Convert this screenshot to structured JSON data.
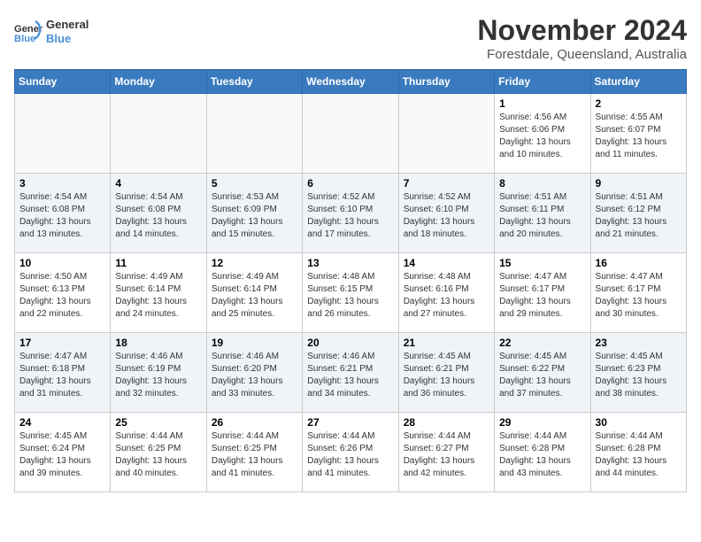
{
  "logo": {
    "line1": "General",
    "line2": "Blue"
  },
  "title": "November 2024",
  "subtitle": "Forestdale, Queensland, Australia",
  "header": {
    "accent_color": "#3a7abf"
  },
  "days_of_week": [
    "Sunday",
    "Monday",
    "Tuesday",
    "Wednesday",
    "Thursday",
    "Friday",
    "Saturday"
  ],
  "weeks": [
    {
      "days": [
        {
          "num": "",
          "info": ""
        },
        {
          "num": "",
          "info": ""
        },
        {
          "num": "",
          "info": ""
        },
        {
          "num": "",
          "info": ""
        },
        {
          "num": "",
          "info": ""
        },
        {
          "num": "1",
          "info": "Sunrise: 4:56 AM\nSunset: 6:06 PM\nDaylight: 13 hours\nand 10 minutes."
        },
        {
          "num": "2",
          "info": "Sunrise: 4:55 AM\nSunset: 6:07 PM\nDaylight: 13 hours\nand 11 minutes."
        }
      ]
    },
    {
      "days": [
        {
          "num": "3",
          "info": "Sunrise: 4:54 AM\nSunset: 6:08 PM\nDaylight: 13 hours\nand 13 minutes."
        },
        {
          "num": "4",
          "info": "Sunrise: 4:54 AM\nSunset: 6:08 PM\nDaylight: 13 hours\nand 14 minutes."
        },
        {
          "num": "5",
          "info": "Sunrise: 4:53 AM\nSunset: 6:09 PM\nDaylight: 13 hours\nand 15 minutes."
        },
        {
          "num": "6",
          "info": "Sunrise: 4:52 AM\nSunset: 6:10 PM\nDaylight: 13 hours\nand 17 minutes."
        },
        {
          "num": "7",
          "info": "Sunrise: 4:52 AM\nSunset: 6:10 PM\nDaylight: 13 hours\nand 18 minutes."
        },
        {
          "num": "8",
          "info": "Sunrise: 4:51 AM\nSunset: 6:11 PM\nDaylight: 13 hours\nand 20 minutes."
        },
        {
          "num": "9",
          "info": "Sunrise: 4:51 AM\nSunset: 6:12 PM\nDaylight: 13 hours\nand 21 minutes."
        }
      ]
    },
    {
      "days": [
        {
          "num": "10",
          "info": "Sunrise: 4:50 AM\nSunset: 6:13 PM\nDaylight: 13 hours\nand 22 minutes."
        },
        {
          "num": "11",
          "info": "Sunrise: 4:49 AM\nSunset: 6:14 PM\nDaylight: 13 hours\nand 24 minutes."
        },
        {
          "num": "12",
          "info": "Sunrise: 4:49 AM\nSunset: 6:14 PM\nDaylight: 13 hours\nand 25 minutes."
        },
        {
          "num": "13",
          "info": "Sunrise: 4:48 AM\nSunset: 6:15 PM\nDaylight: 13 hours\nand 26 minutes."
        },
        {
          "num": "14",
          "info": "Sunrise: 4:48 AM\nSunset: 6:16 PM\nDaylight: 13 hours\nand 27 minutes."
        },
        {
          "num": "15",
          "info": "Sunrise: 4:47 AM\nSunset: 6:17 PM\nDaylight: 13 hours\nand 29 minutes."
        },
        {
          "num": "16",
          "info": "Sunrise: 4:47 AM\nSunset: 6:17 PM\nDaylight: 13 hours\nand 30 minutes."
        }
      ]
    },
    {
      "days": [
        {
          "num": "17",
          "info": "Sunrise: 4:47 AM\nSunset: 6:18 PM\nDaylight: 13 hours\nand 31 minutes."
        },
        {
          "num": "18",
          "info": "Sunrise: 4:46 AM\nSunset: 6:19 PM\nDaylight: 13 hours\nand 32 minutes."
        },
        {
          "num": "19",
          "info": "Sunrise: 4:46 AM\nSunset: 6:20 PM\nDaylight: 13 hours\nand 33 minutes."
        },
        {
          "num": "20",
          "info": "Sunrise: 4:46 AM\nSunset: 6:21 PM\nDaylight: 13 hours\nand 34 minutes."
        },
        {
          "num": "21",
          "info": "Sunrise: 4:45 AM\nSunset: 6:21 PM\nDaylight: 13 hours\nand 36 minutes."
        },
        {
          "num": "22",
          "info": "Sunrise: 4:45 AM\nSunset: 6:22 PM\nDaylight: 13 hours\nand 37 minutes."
        },
        {
          "num": "23",
          "info": "Sunrise: 4:45 AM\nSunset: 6:23 PM\nDaylight: 13 hours\nand 38 minutes."
        }
      ]
    },
    {
      "days": [
        {
          "num": "24",
          "info": "Sunrise: 4:45 AM\nSunset: 6:24 PM\nDaylight: 13 hours\nand 39 minutes."
        },
        {
          "num": "25",
          "info": "Sunrise: 4:44 AM\nSunset: 6:25 PM\nDaylight: 13 hours\nand 40 minutes."
        },
        {
          "num": "26",
          "info": "Sunrise: 4:44 AM\nSunset: 6:25 PM\nDaylight: 13 hours\nand 41 minutes."
        },
        {
          "num": "27",
          "info": "Sunrise: 4:44 AM\nSunset: 6:26 PM\nDaylight: 13 hours\nand 41 minutes."
        },
        {
          "num": "28",
          "info": "Sunrise: 4:44 AM\nSunset: 6:27 PM\nDaylight: 13 hours\nand 42 minutes."
        },
        {
          "num": "29",
          "info": "Sunrise: 4:44 AM\nSunset: 6:28 PM\nDaylight: 13 hours\nand 43 minutes."
        },
        {
          "num": "30",
          "info": "Sunrise: 4:44 AM\nSunset: 6:28 PM\nDaylight: 13 hours\nand 44 minutes."
        }
      ]
    }
  ]
}
